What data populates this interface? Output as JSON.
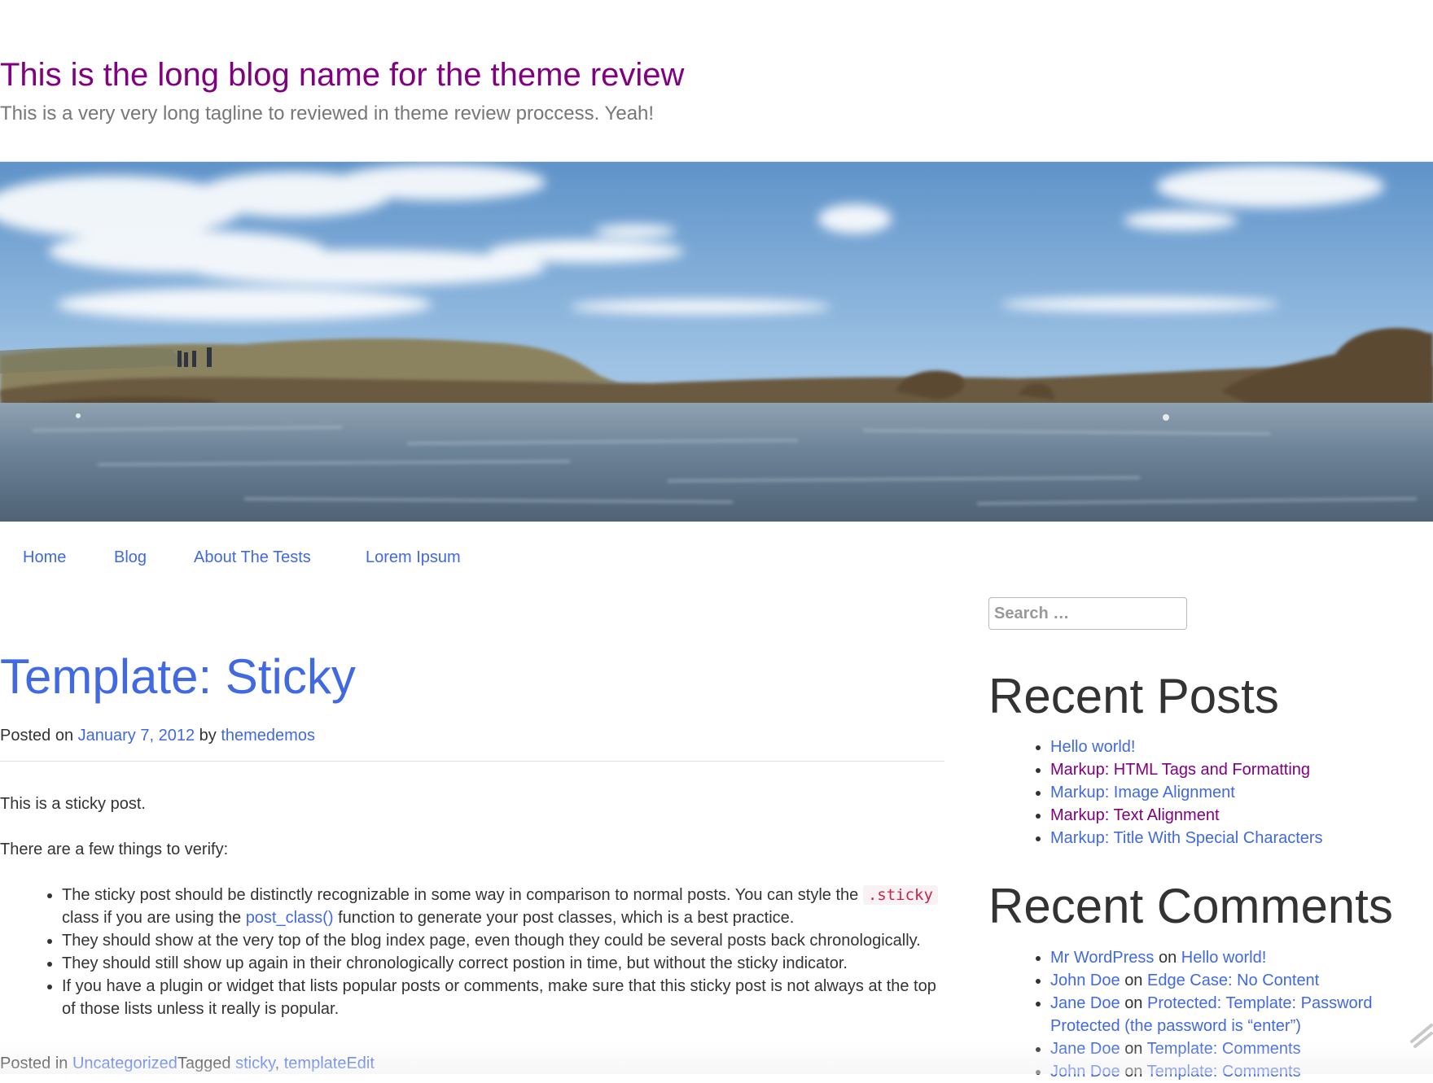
{
  "site": {
    "title": "This is the long blog name for the theme review",
    "tagline": "This is a very very long tagline to reviewed in theme review proccess. Yeah!"
  },
  "nav": {
    "items": [
      {
        "label": "Home"
      },
      {
        "label": "Blog"
      },
      {
        "label": "About The Tests"
      },
      {
        "label": "Lorem Ipsum"
      }
    ]
  },
  "post": {
    "title": "Template: Sticky",
    "meta": {
      "posted_on_label": "Posted on",
      "date": "January 7, 2012",
      "by_label": "by",
      "author": "themedemos"
    },
    "paragraphs": [
      "This is a sticky post.",
      "There are a few things to verify:"
    ],
    "bullets": {
      "b1_text": "The sticky post should be distinctly recognizable in some way in comparison to normal posts. You can style the",
      "b1_code": ".sticky",
      "b1_mid": "class if you are using the",
      "b1_link": "post_class()",
      "b1_end": "function to generate your post classes, which is a best practice.",
      "b2": "They should show at the very top of the blog index page, even though they could be several posts back chronologically.",
      "b3": "They should still show up again in their chronologically correct postion in time, but without the sticky indicator.",
      "b4": "If you have a plugin or widget that lists popular posts or comments, make sure that this sticky post is not always at the top of those lists unless it really is popular."
    },
    "footer": {
      "posted_in_label": "Posted in",
      "category": "Uncategorized",
      "tagged_label": "Tagged",
      "tag1": "sticky",
      "tag_sep": ",",
      "tag2": "template",
      "edit_label": "Edit"
    }
  },
  "sidebar": {
    "search": {
      "placeholder": "Search …"
    },
    "recent_posts": {
      "title": "Recent Posts",
      "items": [
        {
          "label": "Hello world!",
          "visited": false
        },
        {
          "label": "Markup: HTML Tags and Formatting",
          "visited": true
        },
        {
          "label": "Markup: Image Alignment",
          "visited": false
        },
        {
          "label": "Markup: Text Alignment",
          "visited": true
        },
        {
          "label": "Markup: Title With Special Characters",
          "visited": false
        }
      ]
    },
    "recent_comments": {
      "title": "Recent Comments",
      "on_label": "on",
      "items": [
        {
          "author": "Mr WordPress",
          "post": "Hello world!"
        },
        {
          "author": "John Doe",
          "post": "Edge Case: No Content"
        },
        {
          "author": "Jane Doe",
          "post": "Protected: Template: Password Protected (the password is “enter”)"
        },
        {
          "author": "Jane Doe",
          "post": "Template: Comments"
        },
        {
          "author": "John Doe",
          "post": "Template: Comments"
        }
      ]
    }
  },
  "colors": {
    "link": "#4169e1",
    "visited": "#800080",
    "text": "#333333",
    "muted": "#777777"
  },
  "icons": {
    "corner": "pencil-icon"
  }
}
